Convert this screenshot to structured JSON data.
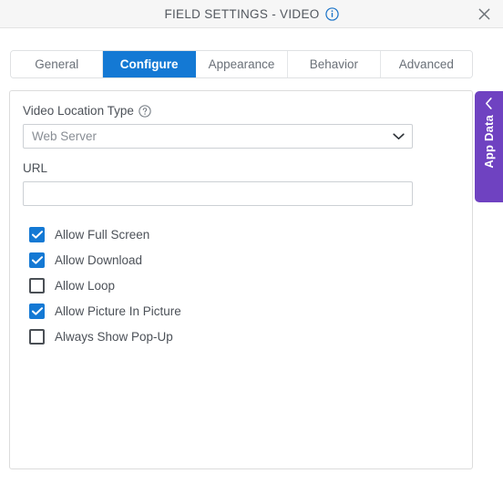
{
  "titlebar": {
    "title": "FIELD SETTINGS - VIDEO",
    "info_icon": "info-circle-icon",
    "close_icon": "close-icon"
  },
  "tabs": [
    {
      "label": "General",
      "active": false
    },
    {
      "label": "Configure",
      "active": true
    },
    {
      "label": "Appearance",
      "active": false
    },
    {
      "label": "Behavior",
      "active": false
    },
    {
      "label": "Advanced",
      "active": false
    }
  ],
  "form": {
    "video_location_type": {
      "label": "Video Location Type",
      "help_icon": "help-circle-icon",
      "value": "Web Server",
      "chevron_icon": "chevron-down-icon"
    },
    "url": {
      "label": "URL",
      "value": "",
      "placeholder": ""
    },
    "checkboxes": [
      {
        "label": "Allow Full Screen",
        "checked": true
      },
      {
        "label": "Allow Download",
        "checked": true
      },
      {
        "label": "Allow Loop",
        "checked": false
      },
      {
        "label": "Allow Picture In Picture",
        "checked": true
      },
      {
        "label": "Always Show Pop-Up",
        "checked": false
      }
    ]
  },
  "app_data_panel": {
    "label": "App Data",
    "chevron_icon": "chevron-left-icon"
  },
  "colors": {
    "accent_blue": "#1479d4",
    "app_data_purple": "#6f42c1",
    "title_text": "#53585f",
    "label_text": "#4c5158"
  }
}
